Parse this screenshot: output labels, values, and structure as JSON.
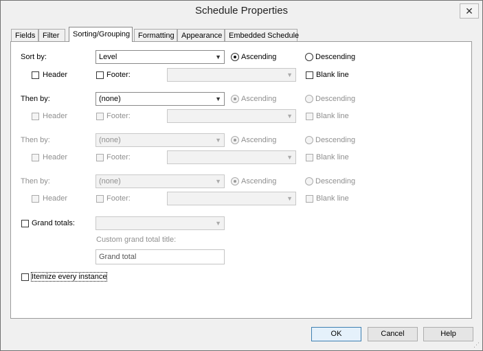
{
  "window": {
    "title": "Schedule Properties",
    "close_icon": "close-icon"
  },
  "tabs": [
    {
      "label": "Fields"
    },
    {
      "label": "Filter"
    },
    {
      "label": "Sorting/Grouping",
      "active": true
    },
    {
      "label": "Formatting"
    },
    {
      "label": "Appearance"
    },
    {
      "label": "Embedded Schedule"
    }
  ],
  "sort_by": {
    "label": "Sort by:",
    "field": "Level",
    "ascending": "Ascending",
    "descending": "Descending",
    "selected_order": "ascending",
    "header": "Header",
    "footer": "Footer:",
    "footer_value": "",
    "blank_line": "Blank line"
  },
  "then_by_1": {
    "label": "Then by:",
    "field": "(none)",
    "ascending": "Ascending",
    "descending": "Descending",
    "header": "Header",
    "footer": "Footer:",
    "blank_line": "Blank line"
  },
  "then_by_2": {
    "label": "Then by:",
    "field": "(none)",
    "ascending": "Ascending",
    "descending": "Descending",
    "header": "Header",
    "footer": "Footer:",
    "blank_line": "Blank line"
  },
  "then_by_3": {
    "label": "Then by:",
    "field": "(none)",
    "ascending": "Ascending",
    "descending": "Descending",
    "header": "Header",
    "footer": "Footer:",
    "blank_line": "Blank line"
  },
  "grand_totals": {
    "label": "Grand totals:",
    "value": "",
    "custom_title_label": "Custom grand total title:",
    "custom_title_value": "Grand total"
  },
  "itemize": {
    "label": "Itemize every instance",
    "checked": false
  },
  "buttons": {
    "ok": "OK",
    "cancel": "Cancel",
    "help": "Help"
  }
}
